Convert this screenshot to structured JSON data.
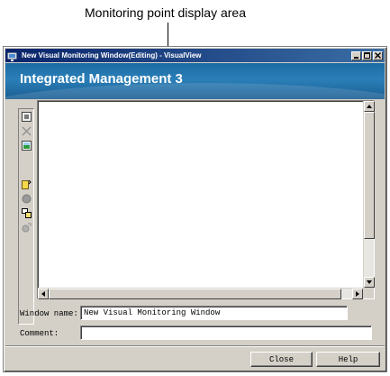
{
  "callout": {
    "label": "Monitoring point display area"
  },
  "window": {
    "title": "New Visual Monitoring Window(Editing) - VisualView",
    "controls": [
      "minimize",
      "maximize",
      "close"
    ]
  },
  "banner": {
    "title": "Integrated Management 3"
  },
  "toolbar": {
    "icons": [
      "properties-icon",
      "delete-icon",
      "background-icon",
      "add-monitoring-point-icon",
      "add-image-icon",
      "add-label-icon",
      "add-unavailable-icon"
    ]
  },
  "form": {
    "window_name_label": "Window name:",
    "window_name_value": "New Visual Monitoring Window",
    "comment_label": "Comment:",
    "comment_value": ""
  },
  "buttons": {
    "close": "Close",
    "help": "Help"
  },
  "colors": {
    "title_bar": "#0a246a",
    "banner": "#1b6aa3",
    "window_bg": "#d4d0c8"
  }
}
